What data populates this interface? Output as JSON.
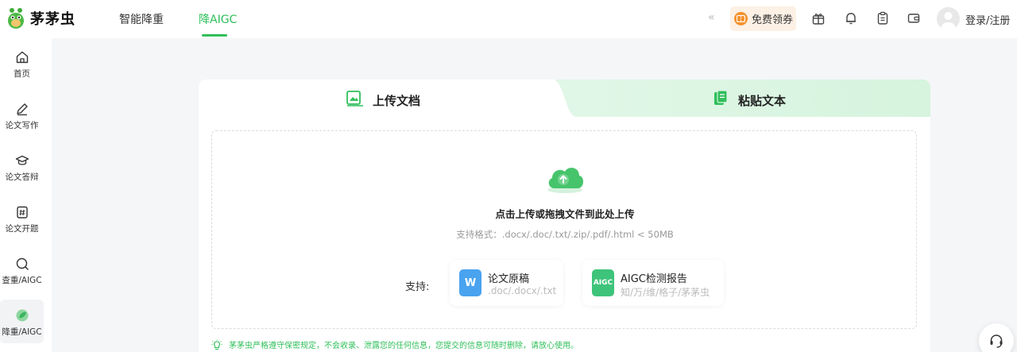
{
  "app": {
    "name": "茅茅虫"
  },
  "nav": [
    {
      "label": "智能降重",
      "active": false
    },
    {
      "label": "降AIGC",
      "active": true
    }
  ],
  "header": {
    "collapse_glyph": "«",
    "coupon_label": "免费领券",
    "login_label": "登录/注册",
    "icons": [
      "gift-icon",
      "bell-icon",
      "clipboard-icon",
      "wallet-icon"
    ]
  },
  "sidebar": {
    "items": [
      {
        "label": "首页",
        "icon": "home-icon",
        "active": false
      },
      {
        "label": "论文写作",
        "icon": "pen-icon",
        "active": false
      },
      {
        "label": "论文答辩",
        "icon": "graduation-cap-icon",
        "active": false
      },
      {
        "label": "论文开题",
        "icon": "hash-doc-icon",
        "active": false
      },
      {
        "label": "查重/AIGC",
        "icon": "search-icon",
        "active": false
      },
      {
        "label": "降重/AIGC",
        "icon": "leaf-icon",
        "active": true
      }
    ]
  },
  "tabs": [
    {
      "label": "上传文档",
      "icon": "image-doc-icon",
      "active": true
    },
    {
      "label": "粘贴文本",
      "icon": "paste-doc-icon",
      "active": false
    }
  ],
  "upload": {
    "title": "点击上传或拖拽文件到此处上传",
    "formats": "支持格式：.docx/.doc/.txt/.zip/.pdf/.html < 50MB",
    "support_label": "支持:",
    "chips": [
      {
        "title": "论文原稿",
        "sub": ".doc/.docx/.txt",
        "icon_text": "W",
        "color": "#4aa3ef"
      },
      {
        "title": "AIGC检测报告",
        "sub": "知/万/维/格子/茅茅虫",
        "icon_text": "AIGC",
        "color": "#3ec47a"
      }
    ]
  },
  "notice": "茅茅虫严格遵守保密规定，不会收录、泄露您的任何信息，您提交的信息可随时删除，请放心使用。",
  "colors": {
    "accent": "#2fbf5a",
    "coupon": "#f6922e"
  }
}
